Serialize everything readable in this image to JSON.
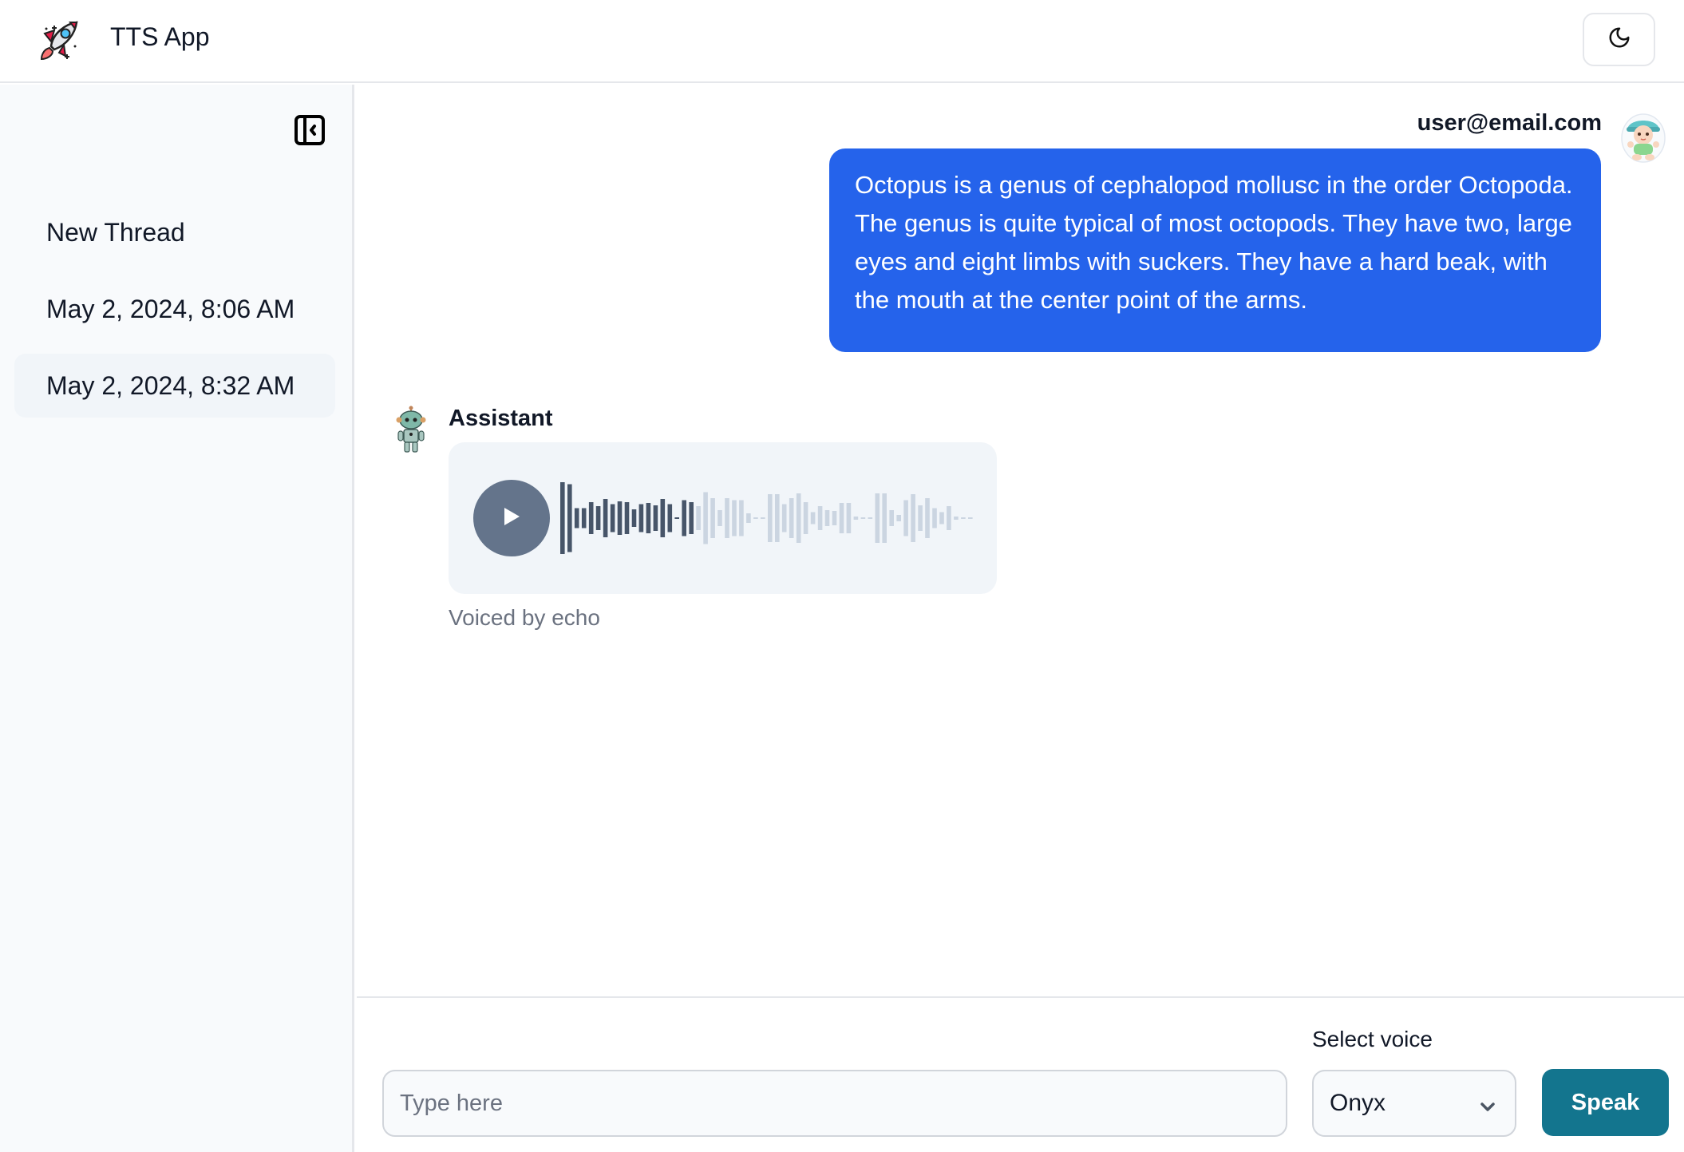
{
  "header": {
    "app_title": "TTS App",
    "logo_icon": "rocket-icon",
    "theme_toggle_icon": "moon-icon"
  },
  "sidebar": {
    "collapse_icon": "sidebar-collapse-icon",
    "threads": [
      {
        "label": "New Thread",
        "active": false
      },
      {
        "label": "May 2, 2024, 8:06 AM",
        "active": false
      },
      {
        "label": "May 2, 2024, 8:32 AM",
        "active": true
      }
    ]
  },
  "chat": {
    "user": {
      "name": "user@email.com",
      "avatar": "baby-avatar",
      "message": "Octopus is a genus of cephalopod mollusc in the order Octopoda. The genus is quite typical of most octopods. They have two, large eyes and eight limbs with suckers. They have a hard beak, with the mouth at the center point of the arms."
    },
    "assistant": {
      "name": "Assistant",
      "avatar": "robot-avatar",
      "audio": {
        "play_icon": "play-icon",
        "progress": 0.33,
        "waveform": [
          0.9,
          0.85,
          0.25,
          0.25,
          0.4,
          0.3,
          0.48,
          0.35,
          0.42,
          0.4,
          0.22,
          0.35,
          0.38,
          0.32,
          0.48,
          0.35,
          0.02,
          0.45,
          0.4,
          0.3,
          0.65,
          0.5,
          0.2,
          0.5,
          0.45,
          0.45,
          0.12,
          0.02,
          0.02,
          0.6,
          0.6,
          0.35,
          0.5,
          0.62,
          0.4,
          0.15,
          0.3,
          0.2,
          0.18,
          0.38,
          0.38,
          0.04,
          0.02,
          0.02,
          0.62,
          0.62,
          0.2,
          0.08,
          0.45,
          0.6,
          0.32,
          0.5,
          0.25,
          0.15,
          0.3,
          0.04,
          0.02,
          0.02
        ]
      },
      "voiced_by": "Voiced by echo"
    }
  },
  "composer": {
    "input_placeholder": "Type here",
    "input_value": "",
    "select_label": "Select voice",
    "selected_voice": "Onyx",
    "speak_label": "Speak"
  },
  "colors": {
    "user_bubble": "#2563eb",
    "speak_button": "#13758e",
    "waveform_played": "#475569",
    "waveform_unplayed": "#cbd5e1",
    "play_button": "#64748b"
  }
}
